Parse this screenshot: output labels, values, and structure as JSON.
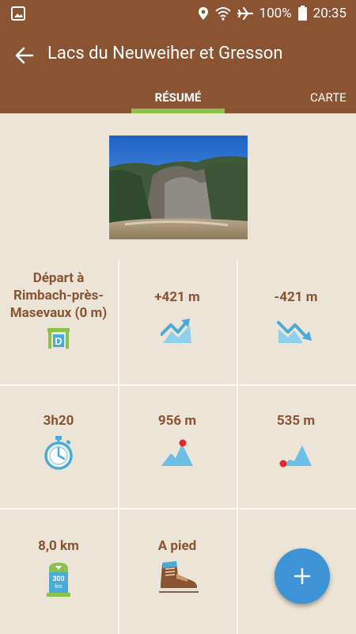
{
  "status_bar": {
    "battery": "100%",
    "time": "20:35",
    "icons": [
      "image-icon",
      "location-icon",
      "wifi-icon",
      "airplane-icon",
      "battery-icon"
    ]
  },
  "app_bar": {
    "title": "Lacs du Neuweiher et Gresson",
    "back_icon": "arrow-left-icon"
  },
  "tabs": [
    {
      "label": "RÉSUMÉ",
      "active": true
    },
    {
      "label": "CARTE",
      "active": false
    }
  ],
  "colors": {
    "brand_brown": "#8a5331",
    "accent_green": "#8bc34a",
    "background": "#ece4d6",
    "icon_blue": "#4aaad8",
    "fab_blue": "#3d93d5"
  },
  "stats": [
    {
      "text": "Départ à Rimbach-près-Masevaux (0 m)",
      "icon": "departure-icon",
      "icon_letter": "D"
    },
    {
      "text": "+421 m",
      "icon": "elevation-gain-icon"
    },
    {
      "text": "-421 m",
      "icon": "elevation-loss-icon"
    },
    {
      "text": "3h20",
      "icon": "stopwatch-icon"
    },
    {
      "text": "956 m",
      "icon": "max-altitude-icon"
    },
    {
      "text": "535 m",
      "icon": "min-altitude-icon"
    },
    {
      "text": "8,0 km",
      "icon": "distance-marker-icon",
      "icon_text": "300",
      "icon_unit": "km"
    },
    {
      "text": "A pied",
      "icon": "hiking-boot-icon"
    }
  ],
  "fab": {
    "icon": "plus-icon"
  }
}
